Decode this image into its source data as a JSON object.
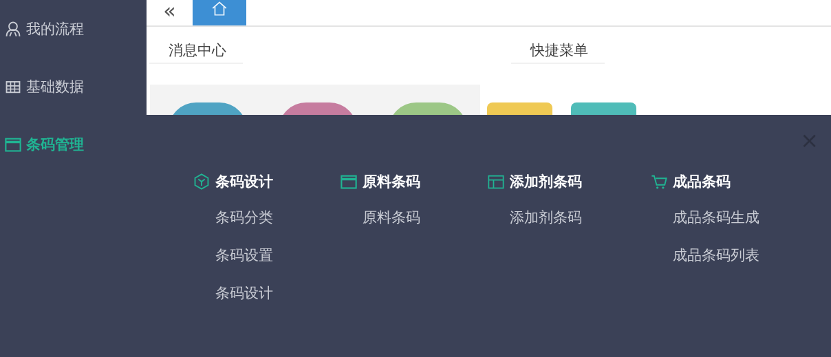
{
  "sidebar": {
    "items": [
      {
        "label": "我的流程",
        "kind": "people",
        "selected": false
      },
      {
        "label": "基础数据",
        "kind": "grid",
        "selected": false
      },
      {
        "label": "条码管理",
        "kind": "window",
        "selected": true
      }
    ]
  },
  "topbar": {
    "collapse": "«",
    "tabs": [
      {
        "kind": "home",
        "selected": true
      }
    ]
  },
  "panels": [
    {
      "title": "消息中心"
    },
    {
      "title": "快捷菜单"
    }
  ],
  "tiles": [
    {
      "kind": "round",
      "color": "#4fa3c3"
    },
    {
      "kind": "round",
      "color": "#c67c9f"
    },
    {
      "kind": "round",
      "color": "#9cc786"
    },
    {
      "kind": "square",
      "color": "#efc954"
    },
    {
      "kind": "square",
      "color": "#4fbcb8"
    }
  ],
  "menu": {
    "close": "×",
    "columns": [
      {
        "title": "条码设计",
        "kind": "box",
        "items": [
          "条码分类",
          "条码设置",
          "条码设计"
        ]
      },
      {
        "title": "原料条码",
        "kind": "window",
        "items": [
          "原料条码"
        ]
      },
      {
        "title": "添加剂条码",
        "kind": "table",
        "items": [
          "添加剂条码"
        ]
      },
      {
        "title": "成品条码",
        "kind": "cart",
        "items": [
          "成品条码生成",
          "成品条码列表"
        ]
      }
    ]
  }
}
